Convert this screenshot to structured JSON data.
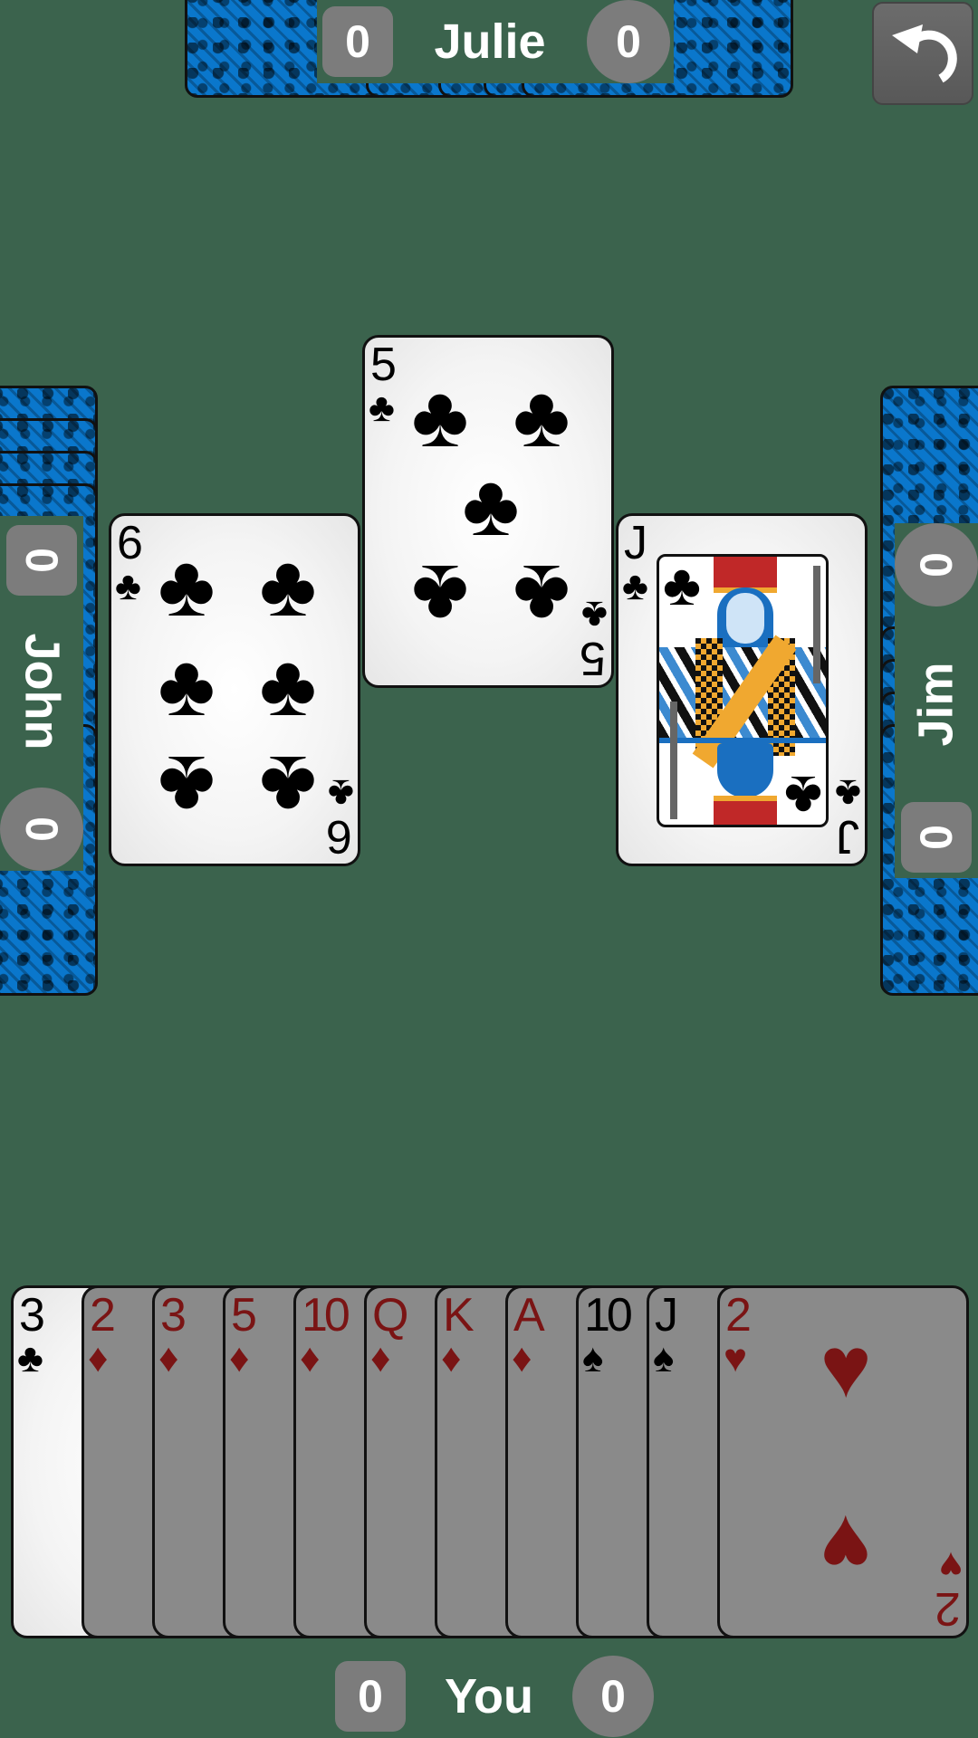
{
  "players": {
    "north": {
      "name": "Julie",
      "score_left": "0",
      "score_right": "0"
    },
    "west": {
      "name": "John",
      "score_left": "0",
      "score_right": "0"
    },
    "east": {
      "name": "Jim",
      "score_left": "0",
      "score_right": "0"
    },
    "south": {
      "name": "You",
      "score_left": "0",
      "score_right": "0"
    }
  },
  "controls": {
    "undo_icon": "undo-arrow-icon"
  },
  "trick": [
    {
      "position": "west",
      "rank": "6",
      "suit": "♣",
      "suit_name": "clubs"
    },
    {
      "position": "north",
      "rank": "5",
      "suit": "♣",
      "suit_name": "clubs"
    },
    {
      "position": "east",
      "rank": "J",
      "suit": "♣",
      "suit_name": "clubs"
    }
  ],
  "hand": [
    {
      "rank": "3",
      "suit": "♣",
      "color": "black",
      "playable": true
    },
    {
      "rank": "2",
      "suit": "♦",
      "color": "red",
      "playable": false
    },
    {
      "rank": "3",
      "suit": "♦",
      "color": "red",
      "playable": false
    },
    {
      "rank": "5",
      "suit": "♦",
      "color": "red",
      "playable": false
    },
    {
      "rank": "10",
      "suit": "♦",
      "color": "red",
      "playable": false
    },
    {
      "rank": "Q",
      "suit": "♦",
      "color": "red",
      "playable": false
    },
    {
      "rank": "K",
      "suit": "♦",
      "color": "red",
      "playable": false
    },
    {
      "rank": "A",
      "suit": "♦",
      "color": "red",
      "playable": false
    },
    {
      "rank": "10",
      "suit": "♠",
      "color": "black",
      "playable": false
    },
    {
      "rank": "J",
      "suit": "♠",
      "color": "black",
      "playable": false
    },
    {
      "rank": "2",
      "suit": "♥",
      "color": "red",
      "playable": false
    }
  ],
  "colors": {
    "table": "#3b634d",
    "card_back": "#0a77cc",
    "score_badge": "#7c7c7c",
    "red_suit": "#7a1414"
  }
}
